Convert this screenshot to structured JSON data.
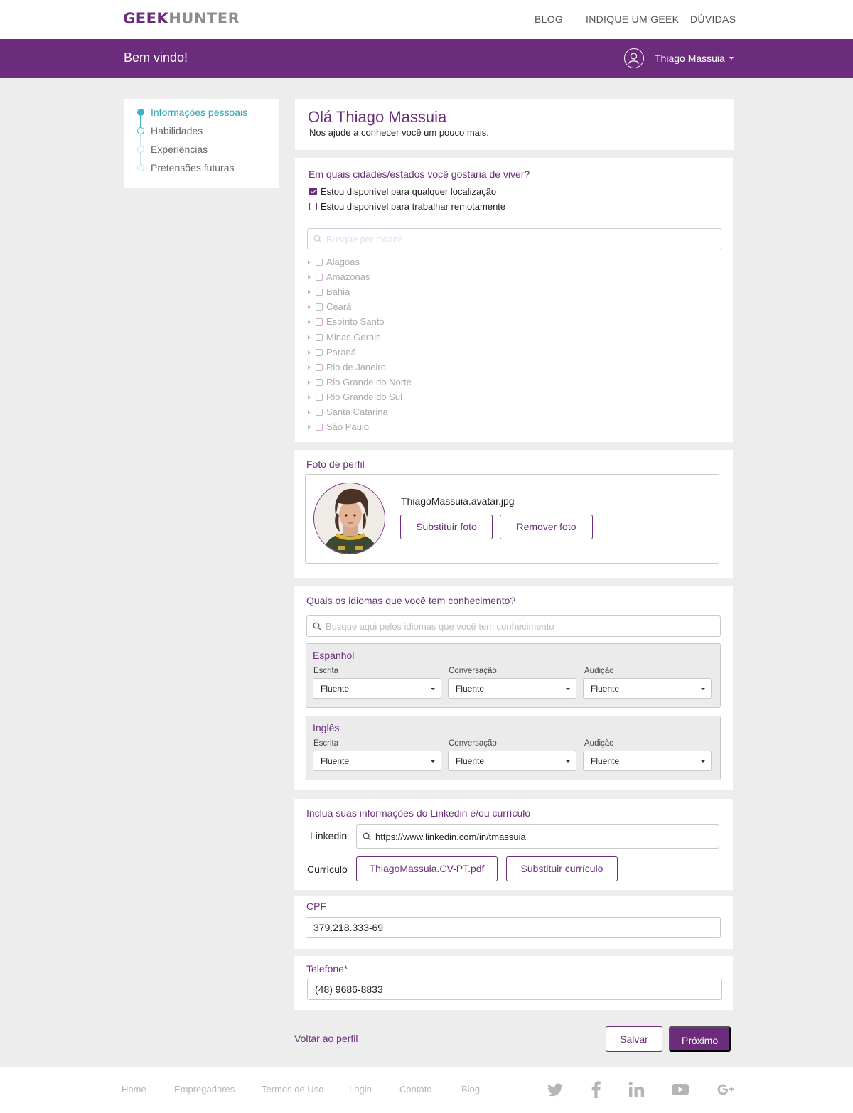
{
  "header": {
    "logo_geek": "GEEK",
    "logo_hunter": "HUNTER",
    "nav": [
      "BLOG",
      "INDIQUE UM GEEK",
      "DÚVIDAS"
    ]
  },
  "welcome": {
    "title": "Bem vindo!",
    "user_name": "Thiago Massuia"
  },
  "steps": [
    {
      "label": "Informações pessoais",
      "state": "active"
    },
    {
      "label": "Habilidades",
      "state": "next"
    },
    {
      "label": "Experiências",
      "state": "pending"
    },
    {
      "label": "Pretensões futuras",
      "state": "pending"
    }
  ],
  "intro": {
    "title": "Olá Thiago Massuia",
    "subtitle": "Nos ajude a conhecer você um pouco mais."
  },
  "location": {
    "question": "Em quais cidades/estados você gostaria de viver?",
    "options": [
      {
        "label": "Estou disponível para qualquer localização",
        "checked": true
      },
      {
        "label": "Estou disponível para trabalhar remotamente",
        "checked": false
      }
    ],
    "search_placeholder": "Busque por cidade",
    "states": [
      "Alagoas",
      "Amazonas",
      "Bahia",
      "Ceará",
      "Espírito Santo",
      "Minas Gerais",
      "Paraná",
      "Rio de Janeiro",
      "Rio Grande do Norte",
      "Rio Grande do Sul",
      "Santa Catarina",
      "São Paulo"
    ]
  },
  "photo": {
    "title": "Foto de perfil",
    "file_name": "ThiagoMassuia.avatar.jpg",
    "replace_label": "Substituir foto",
    "remove_label": "Remover foto"
  },
  "languages": {
    "question": "Quais os idiomas que você tem conhecimento?",
    "search_placeholder": "Busque aqui pelos idiomas que você tem conhecimento",
    "items": [
      {
        "name": "Espanhol",
        "writing_label": "Escrita",
        "writing": "Fluente",
        "conversation_label": "Conversação",
        "conversation": "Fluente",
        "listening_label": "Audição",
        "listening": "Fluente"
      },
      {
        "name": "Inglês",
        "writing_label": "Escrita",
        "writing": "Fluente",
        "conversation_label": "Conversação",
        "conversation": "Fluente",
        "listening_label": "Audição",
        "listening": "Fluente"
      }
    ]
  },
  "linkedin": {
    "title": "Inclua suas informações do Linkedin e/ou currículo",
    "linkedin_label": "Linkedin",
    "linkedin_value": "https://www.linkedin.com/in/tmassuia",
    "cv_label": "Currículo",
    "cv_file": "ThiagoMassuia.CV-PT.pdf",
    "cv_replace": "Substituir currículo"
  },
  "cpf": {
    "label": "CPF",
    "value": "379.218.333-69"
  },
  "phone": {
    "label": "Telefone*",
    "value": "(48) 9686-8833"
  },
  "actions": {
    "back": "Voltar ao perfil",
    "save": "Salvar",
    "next": "Próximo"
  },
  "footer": {
    "links": [
      "Home",
      "Empregadores",
      "Termos de Uso",
      "Login",
      "Contato",
      "Blog"
    ],
    "social": [
      "twitter-icon",
      "facebook-icon",
      "linkedin-icon",
      "youtube-icon",
      "google-plus-icon"
    ]
  },
  "colors": {
    "brand": "#6b2d7b",
    "step_accent": "#3fb3c4",
    "background": "#ededed"
  }
}
